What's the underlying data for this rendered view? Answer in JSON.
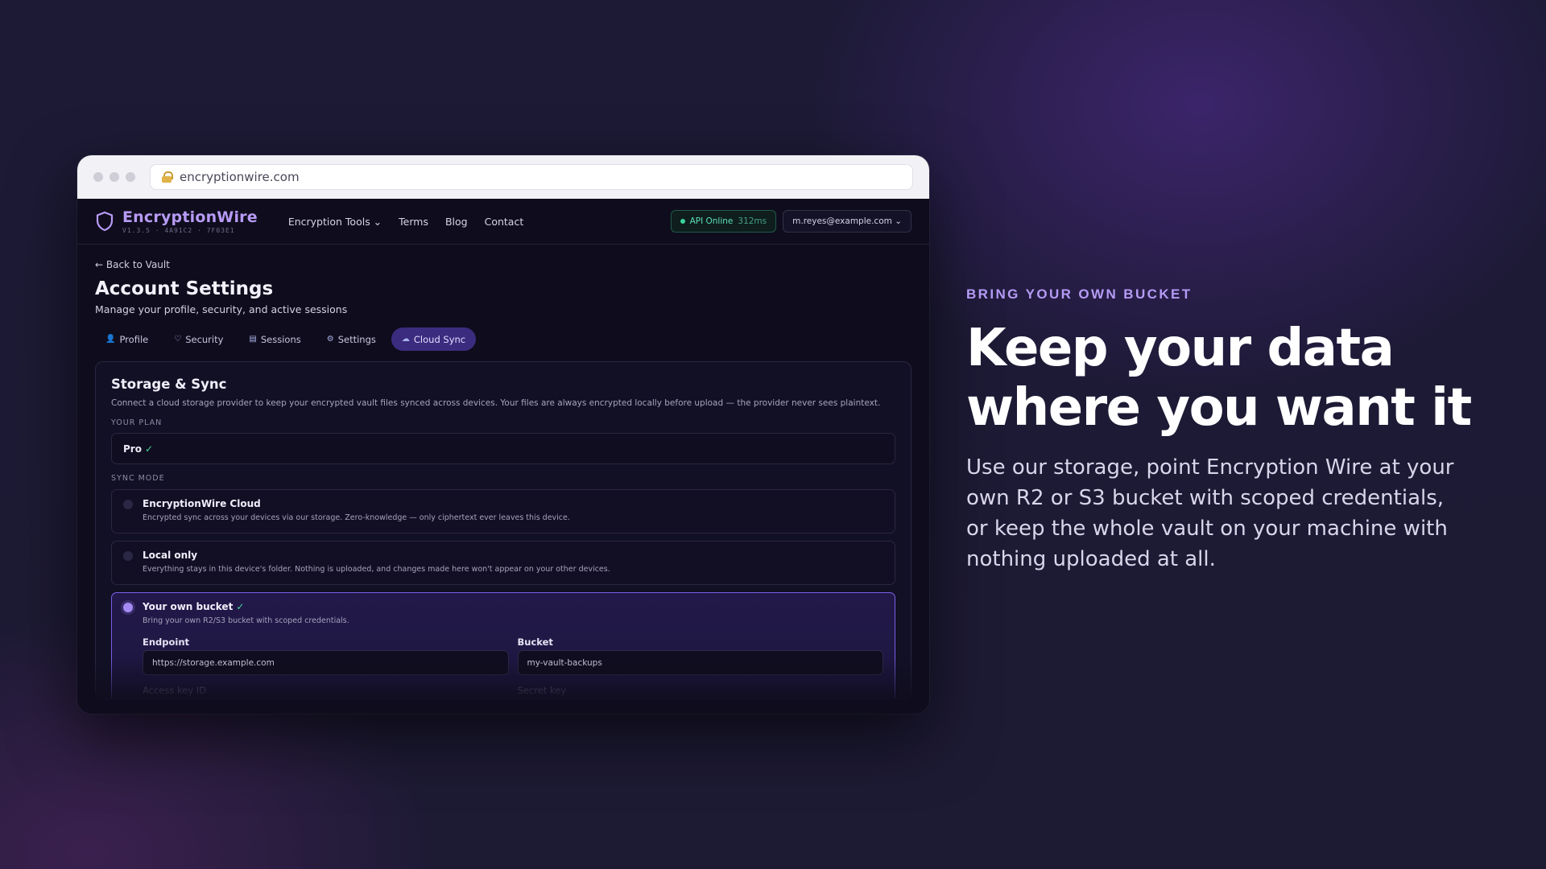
{
  "browser": {
    "url": "encryptionwire.com"
  },
  "navbar": {
    "brand_name": "EncryptionWire",
    "version": "V1.3.5 · 4A91C2 · 7F03E1",
    "links": [
      "Encryption Tools ⌄",
      "Terms",
      "Blog",
      "Contact"
    ],
    "api_status": "API Online",
    "api_latency": "312ms",
    "account": "m.reyes@example.com ⌄"
  },
  "page": {
    "back_link": "← Back to Vault",
    "title": "Account Settings",
    "subtitle": "Manage your profile, security, and active sessions"
  },
  "tabs": [
    {
      "icon": "👤",
      "label": "Profile"
    },
    {
      "icon": "♡",
      "label": "Security"
    },
    {
      "icon": "▤",
      "label": "Sessions"
    },
    {
      "icon": "⚙",
      "label": "Settings"
    },
    {
      "icon": "☁",
      "label": "Cloud Sync",
      "active": true
    }
  ],
  "storage": {
    "title": "Storage & Sync",
    "description": "Connect a cloud storage provider to keep your encrypted vault files synced across devices. Your files are always encrypted locally before upload — the provider never sees plaintext.",
    "plan_label": "YOUR PLAN",
    "plan_value": "Pro",
    "plan_check": "✓",
    "sync_mode_label": "SYNC MODE",
    "options": [
      {
        "title": "EncryptionWire Cloud",
        "desc": "Encrypted sync across your devices via our storage. Zero-knowledge — only ciphertext ever leaves this device."
      },
      {
        "title": "Local only",
        "desc": "Everything stays in this device's folder. Nothing is uploaded, and changes made here won't appear on your other devices."
      },
      {
        "title": "Your own bucket",
        "check": "✓",
        "desc": "Bring your own R2/S3 bucket with scoped credentials."
      }
    ],
    "fields": {
      "endpoint_label": "Endpoint",
      "endpoint_value": "https://storage.example.com",
      "bucket_label": "Bucket",
      "bucket_value": "my-vault-backups",
      "access_key_label": "Access key ID",
      "secret_key_label": "Secret key"
    }
  },
  "hero": {
    "eyebrow": "BRING YOUR OWN BUCKET",
    "headline_line1": "Keep your data",
    "headline_line2": "where you want it",
    "lede": "Use our storage, point Encryption Wire at your own R2 or S3 bucket with scoped credentials, or keep the whole vault on your machine with nothing uploaded at all."
  },
  "colors": {
    "accent": "#b59bf5",
    "tab_active": "#3b2c80",
    "success": "#49d69c",
    "background": "#1b1933"
  }
}
